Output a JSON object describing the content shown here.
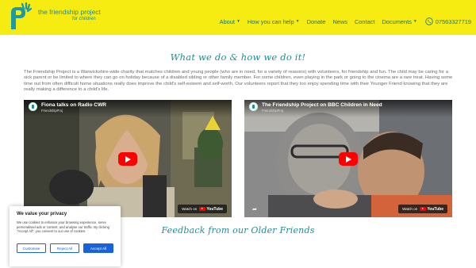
{
  "header": {
    "logo_title": "the friendship project",
    "logo_sub": "for children",
    "nav": [
      {
        "label": "About",
        "has_dropdown": true
      },
      {
        "label": "How you can help",
        "has_dropdown": true
      },
      {
        "label": "Donate",
        "has_dropdown": false
      },
      {
        "label": "News",
        "has_dropdown": false
      },
      {
        "label": "Contact",
        "has_dropdown": false
      },
      {
        "label": "Documents",
        "has_dropdown": true
      }
    ],
    "phone": "07563327719",
    "phone_icon": "phone-icon"
  },
  "main": {
    "heading": "What we do & how we do it!",
    "intro": "The Friendship Project is a Warwickshire-wide charity that matches children and young people (who are in need, for a variety of reasons) with volunteers, for friendship and fun. The child may be caring for a sick parent or be limited to where they can go on holiday because of a disabled sibling or other family member. For some children, even playing in the park or going to the cinema are a rare treat. Having some time out from often difficult home situations really does improve the child's self-esteem and self-worth. Our volunteers report that they too enjoy spending time with their Younger Friend knowing that they are really making a difference to a child's life.",
    "videos": [
      {
        "title": "Fiona talks on Radio CWR",
        "channel": "FriendshipProj",
        "watch_label": "Watch on",
        "yt_label": "YouTube"
      },
      {
        "title": "The Friendship Project on BBC Children in Need",
        "channel": "FriendshipProj",
        "watch_label": "Watch on",
        "yt_label": "YouTube"
      }
    ],
    "feedback_heading": "Feedback from our Older Friends"
  },
  "cookie": {
    "title": "We value your privacy",
    "text": "We use cookies to enhance your browsing experience, serve personalised ads or content, and analyse our traffic. By clicking \"Accept All\", you consent to our use of cookies.",
    "customise": "Customise",
    "reject": "Reject All",
    "accept": "Accept All"
  },
  "colors": {
    "header_bg": "#f7ec12",
    "accent": "#1e8d97",
    "button_blue": "#1863dc"
  }
}
